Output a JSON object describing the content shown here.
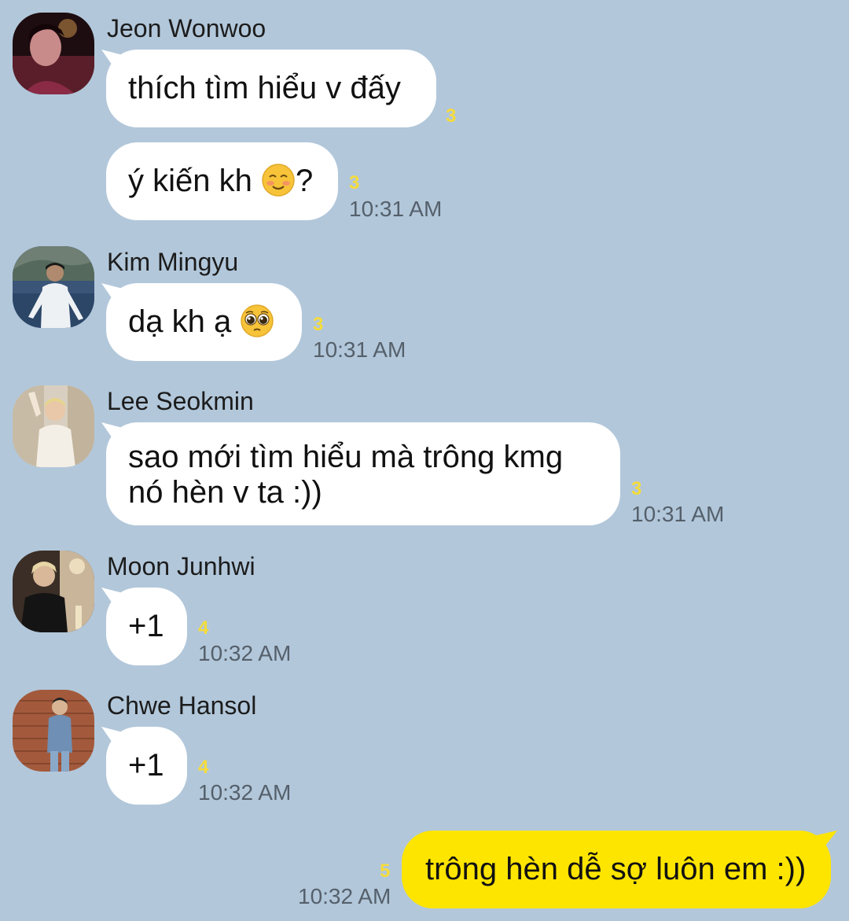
{
  "messages": [
    {
      "sender": "Jeon Wonwoo",
      "bubbles": [
        {
          "text": "thích tìm hiểu v đấy",
          "unread": "3",
          "time": ""
        },
        {
          "text": "ý kiến kh ",
          "suffix": "?",
          "emoji": "smiling-face-with-blush-emoji",
          "unread": "3",
          "time": "10:31 AM"
        }
      ]
    },
    {
      "sender": "Kim Mingyu",
      "bubbles": [
        {
          "text": "dạ kh ạ ",
          "emoji": "pleading-face-emoji",
          "unread": "3",
          "time": "10:31 AM"
        }
      ]
    },
    {
      "sender": "Lee Seokmin",
      "bubbles": [
        {
          "line1": "sao mới tìm hiểu mà trông kmg",
          "line2": "nó hèn v ta :))",
          "unread": "3",
          "time": "10:31 AM"
        }
      ]
    },
    {
      "sender": "Moon Junhwi",
      "bubbles": [
        {
          "text": "+1",
          "unread": "4",
          "time": "10:32 AM"
        }
      ]
    },
    {
      "sender": "Chwe Hansol",
      "bubbles": [
        {
          "text": "+1",
          "unread": "4",
          "time": "10:32 AM"
        }
      ]
    }
  ],
  "my_message": {
    "text": "trông hèn dễ sợ luôn em :))",
    "unread": "5",
    "time": "10:32 AM"
  },
  "colors": {
    "background": "#b2c7da",
    "incoming_bubble": "#ffffff",
    "outgoing_bubble": "#fee500",
    "unread": "#f5dc3c",
    "time": "#55606b"
  }
}
